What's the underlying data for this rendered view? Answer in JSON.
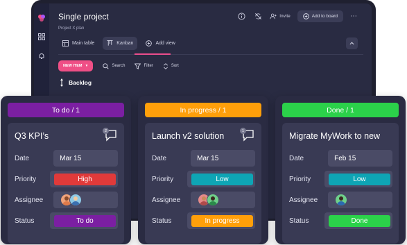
{
  "app": {
    "title": "Single project",
    "subtitle": "Project X plan",
    "invite_label": "Invite",
    "add_to_board_label": "Add to board"
  },
  "tabs": [
    {
      "label": "Main table",
      "icon": "table-icon"
    },
    {
      "label": "Kanban",
      "icon": "kanban-icon",
      "active": true
    },
    {
      "label": "Add view",
      "icon": "plus-circle-icon"
    }
  ],
  "toolbar": {
    "new_item_label": "NEW ITEM",
    "search_label": "Search",
    "filter_label": "Filter",
    "sort_label": "Sort"
  },
  "group": {
    "label": "Backlog"
  },
  "field_labels": {
    "date": "Date",
    "priority": "Priority",
    "assignee": "Assignee",
    "status": "Status"
  },
  "columns": [
    {
      "header": "To do / 1",
      "header_color": "#7b1fa2",
      "card": {
        "title": "Q3 KPI’s",
        "comment_count": "2",
        "date": "Mar 15",
        "priority": "High",
        "priority_color": "#e03a3a",
        "status": "To do",
        "status_color": "#7b1fa2",
        "assignee_count": 2
      }
    },
    {
      "header": "In progress / 1",
      "header_color": "#ff9f0a",
      "card": {
        "title": "Launch v2 solution",
        "comment_count": "1",
        "date": "Mar 15",
        "priority": "Low",
        "priority_color": "#0ea5b5",
        "status": "In progress",
        "status_color": "#ff9f0a",
        "assignee_count": 2
      }
    },
    {
      "header": "Done / 1",
      "header_color": "#2bd14a",
      "card": {
        "title": "Migrate MyWork to new",
        "comment_count": "",
        "date": "Feb 15",
        "priority": "Low",
        "priority_color": "#0ea5b5",
        "status": "Done",
        "status_color": "#2bd14a",
        "assignee_count": 1
      }
    }
  ]
}
